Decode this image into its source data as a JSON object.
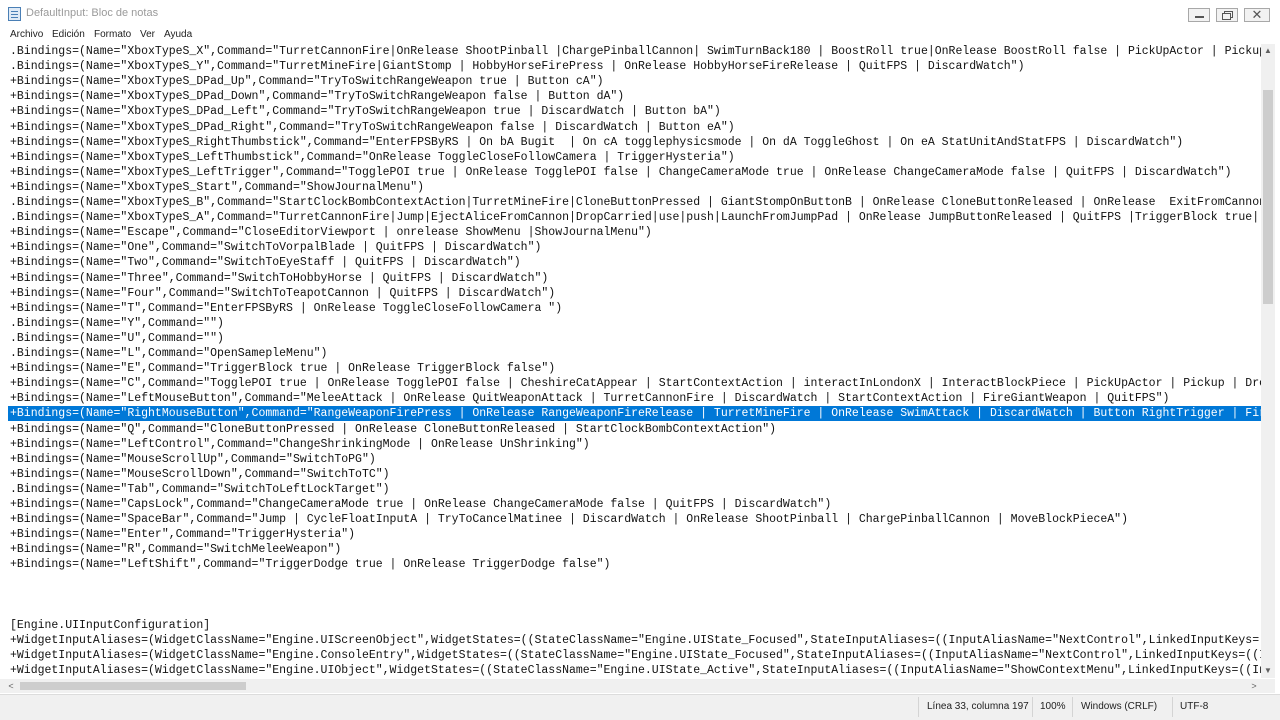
{
  "window": {
    "title": "DefaultInput: Bloc de notas"
  },
  "menu": [
    "Archivo",
    "Edición",
    "Formato",
    "Ver",
    "Ayuda"
  ],
  "editor": {
    "lines": [
      ".Bindings=(Name=\"XboxTypeS_X\",Command=\"TurretCannonFire|OnRelease ShootPinball |ChargePinballCannon| SwimTurnBack180 | BoostRoll true|OnRelease BoostRoll false | PickUpActor | Pickup | Drop",
      ".Bindings=(Name=\"XboxTypeS_Y\",Command=\"TurretMineFire|GiantStomp | HobbyHorseFirePress | OnRelease HobbyHorseFireRelease | QuitFPS | DiscardWatch\")",
      "+Bindings=(Name=\"XboxTypeS_DPad_Up\",Command=\"TryToSwitchRangeWeapon true | Button cA\")",
      "+Bindings=(Name=\"XboxTypeS_DPad_Down\",Command=\"TryToSwitchRangeWeapon false | Button dA\")",
      "+Bindings=(Name=\"XboxTypeS_DPad_Left\",Command=\"TryToSwitchRangeWeapon true | DiscardWatch | Button bA\")",
      "+Bindings=(Name=\"XboxTypeS_DPad_Right\",Command=\"TryToSwitchRangeWeapon false | DiscardWatch | Button eA\")",
      "+Bindings=(Name=\"XboxTypeS_RightThumbstick\",Command=\"EnterFPSByRS | On bA Bugit  | On cA togglephysicsmode | On dA ToggleGhost | On eA StatUnitAndStatFPS | DiscardWatch\")",
      "+Bindings=(Name=\"XboxTypeS_LeftThumbstick\",Command=\"OnRelease ToggleCloseFollowCamera | TriggerHysteria\")",
      "+Bindings=(Name=\"XboxTypeS_LeftTrigger\",Command=\"TogglePOI true | OnRelease TogglePOI false | ChangeCameraMode true | OnRelease ChangeCameraMode false | QuitFPS | DiscardWatch\")",
      "+Bindings=(Name=\"XboxTypeS_Start\",Command=\"ShowJournalMenu\")",
      ".Bindings=(Name=\"XboxTypeS_B\",Command=\"StartClockBombContextAction|TurretMineFire|CloneButtonPressed | GiantStompOnButtonB | OnRelease CloneButtonReleased | OnRelease  ExitFromCannon true|D",
      ".Bindings=(Name=\"XboxTypeS_A\",Command=\"TurretCannonFire|Jump|EjectAliceFromCannon|DropCarried|use|push|LaunchFromJumpPad | OnRelease JumpButtonReleased | QuitFPS |TriggerBlock true| OnRelea",
      "+Bindings=(Name=\"Escape\",Command=\"CloseEditorViewport | onrelease ShowMenu |ShowJournalMenu\")",
      "+Bindings=(Name=\"One\",Command=\"SwitchToVorpalBlade | QuitFPS | DiscardWatch\")",
      "+Bindings=(Name=\"Two\",Command=\"SwitchToEyeStaff | QuitFPS | DiscardWatch\")",
      "+Bindings=(Name=\"Three\",Command=\"SwitchToHobbyHorse | QuitFPS | DiscardWatch\")",
      "+Bindings=(Name=\"Four\",Command=\"SwitchToTeapotCannon | QuitFPS | DiscardWatch\")",
      "+Bindings=(Name=\"T\",Command=\"EnterFPSByRS | OnRelease ToggleCloseFollowCamera \")",
      ".Bindings=(Name=\"Y\",Command=\"\")",
      ".Bindings=(Name=\"U\",Command=\"\")",
      ".Bindings=(Name=\"L\",Command=\"OpenSamepleMenu\")",
      "+Bindings=(Name=\"E\",Command=\"TriggerBlock true | OnRelease TriggerBlock false\")",
      "+Bindings=(Name=\"C\",Command=\"TogglePOI true | OnRelease TogglePOI false | CheshireCatAppear | StartContextAction | interactInLondonX | InteractBlockPiece | PickUpActor | Pickup | DropCarrie",
      "+Bindings=(Name=\"LeftMouseButton\",Command=\"MeleeAttack | OnRelease QuitWeaponAttack | TurretCannonFire | DiscardWatch | StartContextAction | FireGiantWeapon | QuitFPS\")",
      "+Bindings=(Name=\"RightMouseButton\",Command=\"RangeWeaponFirePress | OnRelease RangeWeaponFireRelease | TurretMineFire | OnRelease SwimAttack | DiscardWatch | Button RightTrigger | FireGiantW",
      "+Bindings=(Name=\"Q\",Command=\"CloneButtonPressed | OnRelease CloneButtonReleased | StartClockBombContextAction\")",
      "+Bindings=(Name=\"LeftControl\",Command=\"ChangeShrinkingMode | OnRelease UnShrinking\")",
      "+Bindings=(Name=\"MouseScrollUp\",Command=\"SwitchToPG\")",
      "+Bindings=(Name=\"MouseScrollDown\",Command=\"SwitchToTC\")",
      ".Bindings=(Name=\"Tab\",Command=\"SwitchToLeftLockTarget\")",
      "+Bindings=(Name=\"CapsLock\",Command=\"ChangeCameraMode true | OnRelease ChangeCameraMode false | QuitFPS | DiscardWatch\")",
      "+Bindings=(Name=\"SpaceBar\",Command=\"Jump | CycleFloatInputA | TryToCancelMatinee | DiscardWatch | OnRelease ShootPinball | ChargePinballCannon | MoveBlockPieceA\")",
      "+Bindings=(Name=\"Enter\",Command=\"TriggerHysteria\")",
      "+Bindings=(Name=\"R\",Command=\"SwitchMeleeWeapon\")",
      "+Bindings=(Name=\"LeftShift\",Command=\"TriggerDodge true | OnRelease TriggerDodge false\")",
      "",
      "",
      "",
      "[Engine.UIInputConfiguration]",
      "+WidgetInputAliases=(WidgetClassName=\"Engine.UIScreenObject\",WidgetStates=((StateClassName=\"Engine.UIState_Focused\",StateInputAliases=((InputAliasName=\"NextControl\",LinkedInputKeys=((InputK",
      "+WidgetInputAliases=(WidgetClassName=\"Engine.ConsoleEntry\",WidgetStates=((StateClassName=\"Engine.UIState_Focused\",StateInputAliases=((InputAliasName=\"NextControl\",LinkedInputKeys=((InputKey",
      "+WidgetInputAliases=(WidgetClassName=\"Engine.UIObject\",WidgetStates=((StateClassName=\"Engine.UIState_Active\",StateInputAliases=((InputAliasName=\"ShowContextMenu\",LinkedInputKeys=((InputKeyN"
    ],
    "selected_line": 24
  },
  "status": {
    "position": "Línea 33, columna 197",
    "zoom": "100%",
    "line_ending": "Windows (CRLF)",
    "encoding": "UTF-8"
  },
  "colors": {
    "selection": "#0078d7",
    "chrome": "#f0f0f0"
  }
}
